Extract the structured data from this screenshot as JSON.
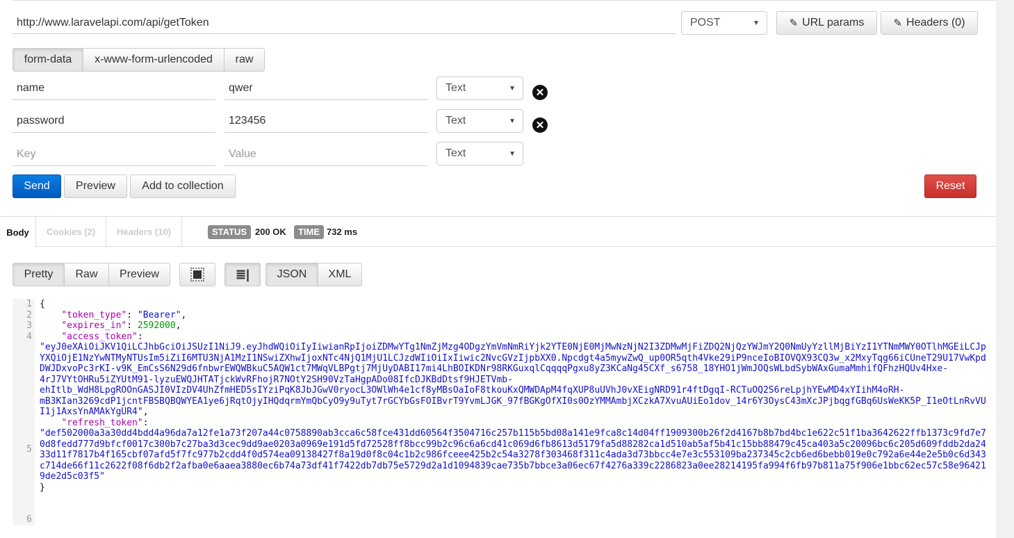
{
  "request": {
    "url": "http://www.laravelapi.com/api/getToken",
    "method": "POST",
    "url_params_label": "URL params",
    "headers_label": "Headers (0)",
    "body_tabs": [
      "form-data",
      "x-www-form-urlencoded",
      "raw"
    ],
    "active_body_tab": "form-data",
    "rows": [
      {
        "key": "name",
        "value": "qwer",
        "type": "Text"
      },
      {
        "key": "password",
        "value": "123456",
        "type": "Text"
      }
    ],
    "new_row": {
      "key_placeholder": "Key",
      "value_placeholder": "Value",
      "type": "Text"
    },
    "send_label": "Send",
    "preview_label": "Preview",
    "add_collection_label": "Add to collection",
    "reset_label": "Reset"
  },
  "response": {
    "tabs": [
      "Body",
      "Cookies (2)",
      "Headers (10)"
    ],
    "active_tab": "Body",
    "status_label": "STATUS",
    "status_value": "200 OK",
    "time_label": "TIME",
    "time_value": "732 ms",
    "view_modes": [
      "Pretty",
      "Raw",
      "Preview"
    ],
    "active_view": "Pretty",
    "formats": [
      "JSON",
      "XML"
    ],
    "active_format": "JSON",
    "line_numbers": [
      "1",
      "2",
      "3",
      "4",
      "5",
      "6"
    ],
    "json": {
      "open": "{",
      "token_type_key": "\"token_type\"",
      "token_type_value": "\"Bearer\"",
      "expires_in_key": "\"expires_in\"",
      "expires_in_value": "2592000",
      "access_token_key": "\"access_token\"",
      "access_token_value": "\"eyJ0eXAiOiJKV1QiLCJhbGciOiJSUzI1NiJ9.eyJhdWQiOiIyIiwianRpIjoiZDMwYTg1NmZjMzg4ODgzYmVmNmRiYjk2YTE0NjE0MjMwNzNjN2I3ZDMwMjFiZDQ2NjQzYWJmY2Q0NmUyYzllMjBiYzI1YTNmMWY0OTlhMGEiLCJpYXQiOjE1NzYwNTMyNTUsIm5iZiI6MTU3NjA1MzI1NSwiZXhwIjoxNTc4NjQ1MjU1LCJzdWIiOiIxIiwic2NvcGVzIjpbXX0.Npcdgt4a5mywZwQ_up0OR5qth4Vke29iP9nceIoBIOVQX93CQ3w_x2MxyTqg66iCUneT29U17VwKpdDWJDxvoPc3rKI-v9K_EmCsS6N29d6fnbwrEWQWBkuC5AQW1ct7MWqVLBPgtj7MjUyDABI17mi4LhBOIKDNr98RKGuxqlCqqqqPgxu8yZ3KCaNg45CXf_s6758_18YHO1jWmJOQsWLbdSybWAxGumaMmhifQFhzHQUv4Hxe-4rJ7VYtOHRu5iZYUtM91-lyzuEWQJHTATjckWvRFhojR7NOtY2SH90VzTaHgpADo08IfcDJKBdDtsf9HJETVmb-ehItlb_WdH8LpgROOnGASJI0VIzDV4UhZfmHED5sIYziPqK8JbJGwV0ryocL3OWlWh4e1cf8yMBsOaIoF8tkouKxQMWDApM4fqXUP8uUVhJ0vXEigNRD91r4ftDgqI-RCTuOQ2S6reLpjhYEwMD4xYIihM4oRH-mB3KIan3269cdP1jcntFBSBQBQWYEA1ye6jRqtOjyIHQdqrmYmQbCyO9y9uTyt7rGCYbGsFOIBvrT9YvmLJGK_97fBGKgOfXI0s0OzYMMAmbjXCzkA7XvuAUiEo1dov_14r6Y3OysC43mXcJPjbqgfGBq6UsWeKK5P_I1eOtLnRvVUI1j1AxsYnAMAkYgUR4\"",
      "refresh_token_key": "\"refresh_token\"",
      "refresh_token_value": "\"def502000a3a30dd4bdd4a96da7a12fe1a73f207a44c0758890ab3cca6c58fce431dd60564f3504716c257b115b5bd08a141e9fca8c14d04ff1909300b26f2d4167b8b7bd4bc1e622c51f1ba3642622ffb1373c9fd7e70d8fedd777d9bfcf0017c300b7c27ba3d3cec9dd9ae0203a0969e191d5fd72528ff8bcc99b2c96c6a6cd41c069d6fb8613d5179fa5d88282ca1d510ab5af5b41c15bb88479c45ca403a5c20096bc6c205d609fddb2da2433d11f7817b4f165cbf07afd5f7fc977b2cdd4f0d574ea09138427f8a19d0f8c04c1b2c986fceee425b2c54a3278f303468f311c4ada3d73bbcc4e7e3c553109ba237345c2cb6ed6bebb019e0c792a6e44e2e5b0c6d343c714de66f11c2622f08f6db2f2afba0e6aaea3880ec6b74a73df41f7422db7db75e5729d2a1d1094839cae735b7bbce3a06ec67f4276a339c2286823a0ee28214195fa994f6fb97b811a75f906e1bbc62ec57c58e964219de2d5c03f5\"",
      "close": "}"
    }
  }
}
